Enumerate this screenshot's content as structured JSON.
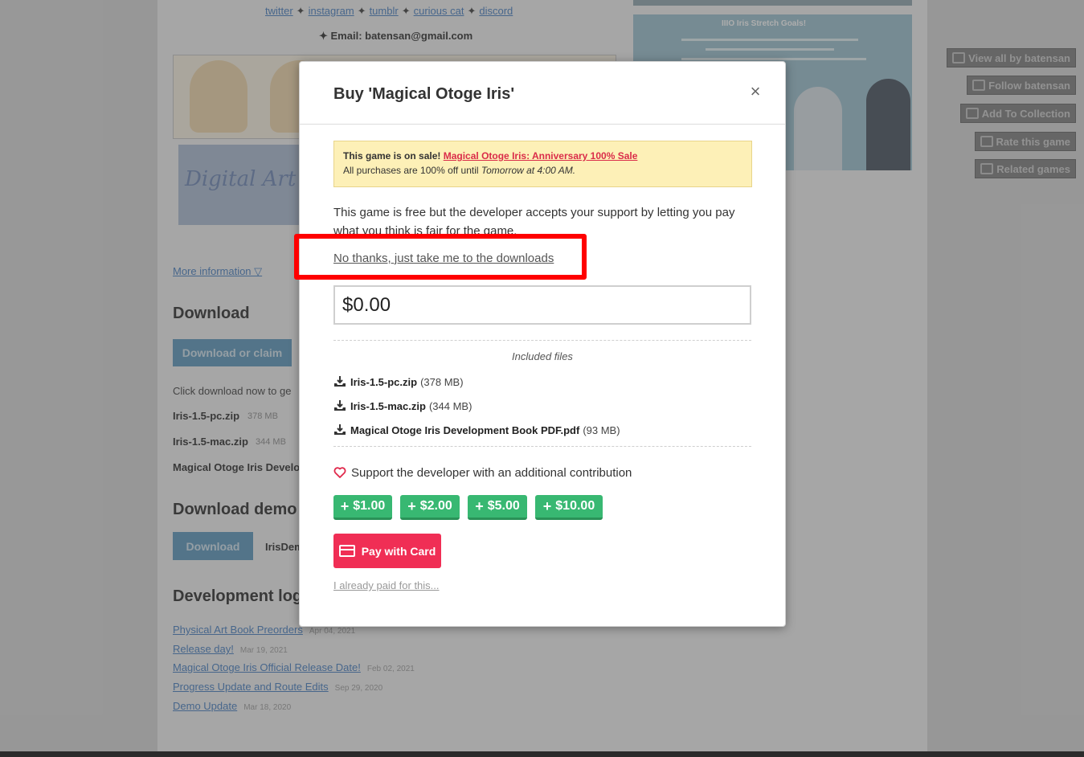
{
  "background": {
    "social_links": [
      "twitter",
      "instagram",
      "tumblr",
      "curious cat",
      "discord"
    ],
    "social_separator": "✦",
    "email_line": "✦ Email: batensan@gmail.com",
    "banner_text": "Digital Art",
    "promo_title": "IIIO Iris Stretch Goals!",
    "more_information": "More information ▽",
    "download_heading": "Download",
    "download_claim_button": "Download or claim",
    "click_download_text": "Click download now to ge",
    "files": [
      {
        "name": "Iris-1.5-pc.zip",
        "size": "378 MB"
      },
      {
        "name": "Iris-1.5-mac.zip",
        "size": "344 MB"
      },
      {
        "name": "Magical Otoge Iris Develo",
        "size": ""
      }
    ],
    "download_demo_heading": "Download demo",
    "demo_button": "Download",
    "demo_file": "IrisDem",
    "devlog_heading": "Development log",
    "devlog_entries": [
      {
        "title": "Physical Art Book Preorders",
        "date": "Apr 04, 2021"
      },
      {
        "title": "Release day!",
        "date": "Mar 19, 2021"
      },
      {
        "title": "Magical Otoge Iris Official Release Date!",
        "date": "Feb 02, 2021"
      },
      {
        "title": "Progress Update and Route Edits",
        "date": "Sep 29, 2020"
      },
      {
        "title": "Demo Update",
        "date": "Mar 18, 2020"
      }
    ],
    "sidebar_buttons": [
      {
        "label": "View all by batensan",
        "icon": "store-icon"
      },
      {
        "label": "Follow batensan",
        "icon": "follow-icon"
      },
      {
        "label": "Add To Collection",
        "icon": "collection-icon"
      },
      {
        "label": "Rate this game",
        "icon": "star-icon"
      },
      {
        "label": "Related games",
        "icon": "map-icon"
      }
    ]
  },
  "modal": {
    "title": "Buy 'Magical Otoge Iris'",
    "close_glyph": "×",
    "sale": {
      "prefix": "This game is on sale!",
      "link": "Magical Otoge Iris: Anniversary 100% Sale",
      "line2_prefix": "All purchases are 100% off until",
      "line2_time": "Tomorrow at 4:00 AM."
    },
    "free_text": "This game is free but the developer accepts your support by letting you pay what you think is fair for the game.",
    "no_thanks": "No thanks, just take me to the downloads",
    "price_value": "$0.00",
    "included_files_label": "Included files",
    "files": [
      {
        "name": "Iris-1.5-pc.zip",
        "size": "(378 MB)"
      },
      {
        "name": "Iris-1.5-mac.zip",
        "size": "(344 MB)"
      },
      {
        "name": "Magical Otoge Iris Development Book PDF.pdf",
        "size": "(93 MB)"
      }
    ],
    "support_text": "Support the developer with an additional contribution",
    "tip_buttons": [
      "$1.00",
      "$2.00",
      "$5.00",
      "$10.00"
    ],
    "pay_button": "Pay with Card",
    "already_paid": "I already paid for this..."
  },
  "colors": {
    "tip_green": "#38b872",
    "pay_red": "#f02e55",
    "sale_bg": "#fdf0b7",
    "highlight": "#ff0000"
  }
}
